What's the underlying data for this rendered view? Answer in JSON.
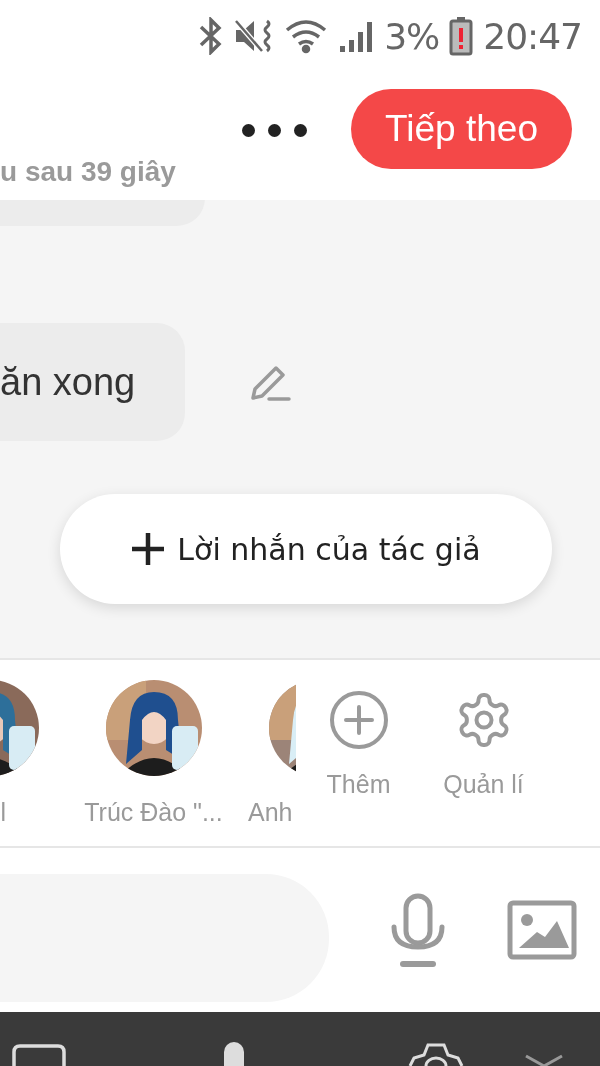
{
  "status_bar": {
    "battery": "3%",
    "time": "20:47"
  },
  "header": {
    "hint": "u sau 39 giây",
    "next_button": "Tiếp theo"
  },
  "messages": [
    {
      "text": "ăn xong"
    }
  ],
  "author_note_button": "Lời nhắn của tác giả",
  "contacts": [
    {
      "name": "l"
    },
    {
      "name": "Trúc Đào \"..."
    },
    {
      "name": "Anh"
    }
  ],
  "actions": [
    {
      "kind": "add",
      "label": "Thêm"
    },
    {
      "kind": "manage",
      "label": "Quản lí"
    }
  ]
}
